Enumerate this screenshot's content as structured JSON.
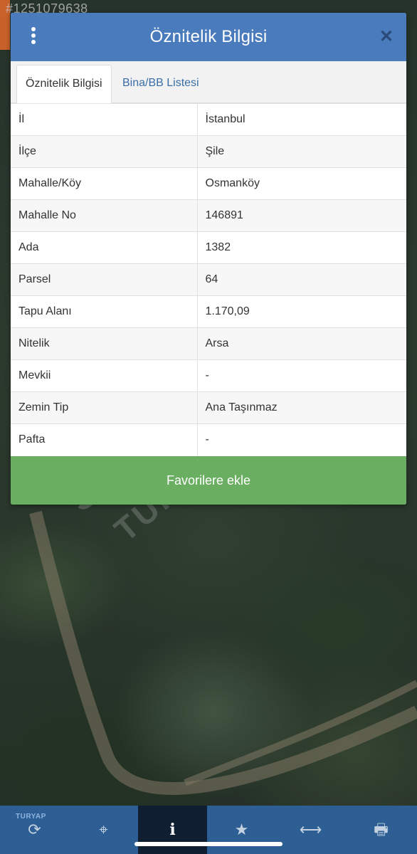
{
  "background": {
    "id_text": "#1251079638",
    "watermark_line1": "satış",
    "watermark_line2": "TURYAP"
  },
  "modal": {
    "title": "Öznitelik Bilgisi",
    "tabs": [
      {
        "label": "Öznitelik Bilgisi",
        "active": true
      },
      {
        "label": "Bina/BB Listesi",
        "active": false
      }
    ],
    "rows": [
      {
        "key": "İl",
        "value": "İstanbul"
      },
      {
        "key": "İlçe",
        "value": "Şile"
      },
      {
        "key": "Mahalle/Köy",
        "value": "Osmanköy"
      },
      {
        "key": "Mahalle No",
        "value": "146891"
      },
      {
        "key": "Ada",
        "value": "1382"
      },
      {
        "key": "Parsel",
        "value": "64"
      },
      {
        "key": "Tapu Alanı",
        "value": "1.170,09"
      },
      {
        "key": "Nitelik",
        "value": "Arsa"
      },
      {
        "key": "Mevkii",
        "value": "-"
      },
      {
        "key": "Zemin Tip",
        "value": "Ana Taşınmaz"
      },
      {
        "key": "Pafta",
        "value": "-"
      }
    ],
    "favorite_label": "Favorilere ekle"
  },
  "toolbar": {
    "brand": "TURYAP",
    "buttons": [
      {
        "icon": "refresh-icon",
        "glyph": "⟳",
        "active": false
      },
      {
        "icon": "crosshair-icon",
        "glyph": "⌖",
        "active": false
      },
      {
        "icon": "info-icon",
        "glyph": "i",
        "active": true
      },
      {
        "icon": "star-icon",
        "glyph": "★",
        "active": false
      },
      {
        "icon": "measure-icon",
        "glyph": "⟷",
        "active": false
      },
      {
        "icon": "print-icon",
        "glyph": "🖶",
        "active": false
      }
    ]
  },
  "colors": {
    "header": "#4a7bbd",
    "favorite": "#6aae62",
    "toolbar": "#2d5f95",
    "toolbar_active": "#0f1e30"
  }
}
